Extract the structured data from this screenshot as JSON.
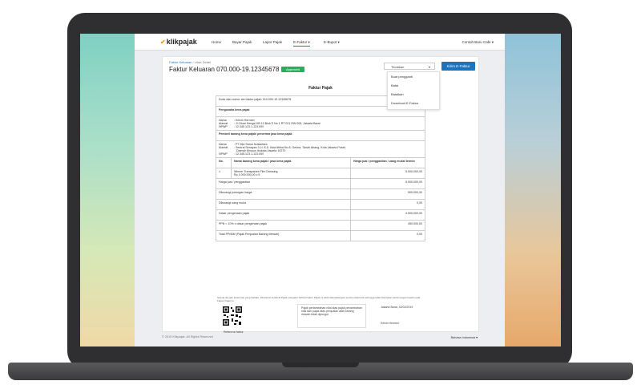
{
  "topbar": {
    "logo": "klikpajak",
    "nav": [
      "Home",
      "Bayar Pajak",
      "Lapor Pajak",
      "E-Faktur",
      "E-Bupot"
    ],
    "company": "Contoh Baru Cafe"
  },
  "header": {
    "breadcrumb_link": "Faktur Keluaran",
    "breadcrumb_rest": " / Lihat Detail",
    "title": "Faktur Keluaran 070.000-19.12345678",
    "status": "Approved",
    "action_select": "Tindakan",
    "send_button": "Kirim E-Faktur"
  },
  "dropdown": [
    "Buat pengganti",
    "Batal",
    "Batalkan",
    "Download E-Faktur"
  ],
  "doc": {
    "title": "Faktur Pajak",
    "kode": "Kode dan nomor seri faktur pajak: 010.000-19.12345678",
    "pengusaha_label": "Pengusaha kena pajak",
    "pengusaha": {
      "nama_label": "Nama",
      "nama": "Kelvin Hermen",
      "alamat_label": "Alamat",
      "alamat": "Jl Cikan Hengsi KB 10 Blok E No 1 RT 021 RW 005, Jakarta Barat",
      "npwp_label": "NPWP",
      "npwp": "12.345.123.1-123.000"
    },
    "pembeli_label": "Pembeli barang kena pajak/ penerima jasa kena pajak",
    "pembeli": {
      "nama_label": "Nama",
      "nama": "PT Mid Sanur Nusantara",
      "alamat_label": "Alamat",
      "alamat1": "Sentral Senayan 3 Lt. 8 Jl. Asia Afrika No 8, Gelora, Tanah Abang, Kota Jakarta Pusat,",
      "alamat2": "Daerah Khusus Ibukota Jakarta 10270",
      "npwp_label": "NPWP",
      "npwp": "12.345.123.1-123.000"
    },
    "table_headers": {
      "no": "No.",
      "name": "Nama barang kena pajak / jasa kena pajak",
      "price": "Harga jual / penggantian / uang muka/ termin"
    },
    "item": {
      "no": "1",
      "name": "Winner Transparent Film Dressing",
      "sub": "Rp 1.000.000,00 x 5",
      "price": "5.000.000,00"
    },
    "totals": [
      {
        "label": "Harga jual / penggantian",
        "value": "5.000.000,00"
      },
      {
        "label": "Dikurangi potongan harga",
        "value": "500.000,00"
      },
      {
        "label": "Dikurangi uang muka",
        "value": "0,00"
      },
      {
        "label": "Dasar pengenaan pajak",
        "value": "4.500.000,00"
      },
      {
        "label": "PPN = 10% x dasar pengenaan pajak",
        "value": "450.000,00"
      },
      {
        "label": "Total PPnBM (Pajak Penjualan Barang Mewah)",
        "value": "0,00"
      }
    ],
    "note": "Sesuai dengan ketentuan yang berlaku, Direktorat Jenderal Pajak mengatur bahwa Faktur Pajak ini telah ditandatangani secara elektronik sehingga tidak diperlukan tanda tangan basah pada Faktur Pajak ini.",
    "qr_label": "Referensi faktur",
    "stamp": "Pajak pertambahan nilai atas pajak penambahan nilai dan pajak atas penjualan atas barang mewah tidak dipungut",
    "place": "Jakarta Barat, 02/02/2019",
    "signer": "Kelvin Hermen"
  },
  "footer": {
    "copyright": "© 2019 Klikpajak. All Rights Reserved",
    "language": "Bahasa Indonesia"
  }
}
